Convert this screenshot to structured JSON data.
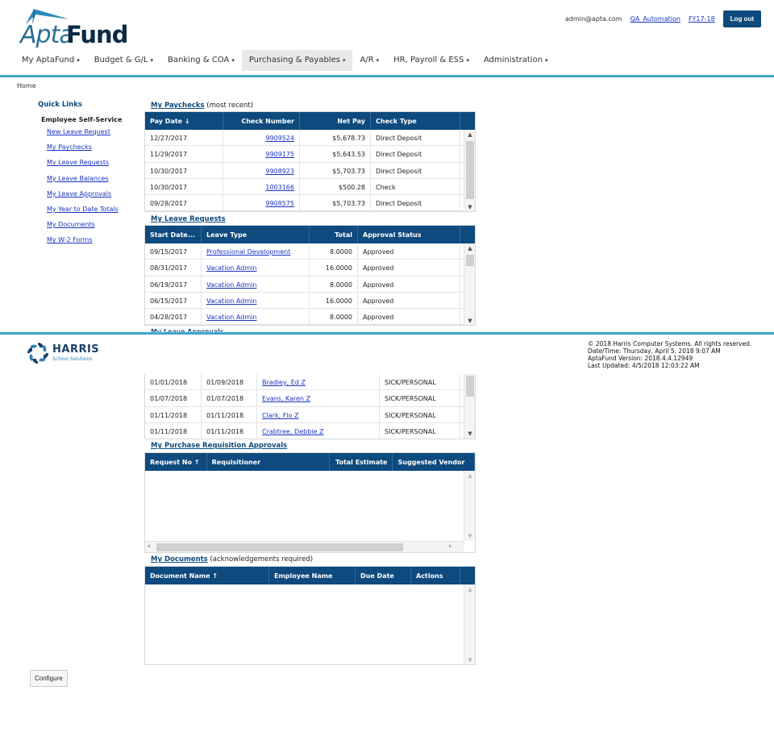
{
  "brand": {
    "apta": "Apta",
    "fund": "Fund"
  },
  "user": {
    "email": "admin@apta.com",
    "name": "QA_Automation",
    "fiscal_year": "FY17-18",
    "logout_label": "Log out"
  },
  "nav": [
    {
      "label": "My AptaFund",
      "caret": "▾"
    },
    {
      "label": "Budget & G/L",
      "caret": "▾"
    },
    {
      "label": "Banking & COA",
      "caret": "▾"
    },
    {
      "label": "Purchasing & Payables",
      "caret": "▾",
      "active": true
    },
    {
      "label": "A/R",
      "caret": "▾"
    },
    {
      "label": "HR, Payroll & ESS",
      "caret": "▾"
    },
    {
      "label": "Administration",
      "caret": "▾"
    }
  ],
  "breadcrumb": "Home",
  "quick_links": {
    "title": "Quick Links",
    "section": "Employee Self-Service",
    "items": [
      "New Leave Request",
      "My Paychecks",
      "My Leave Requests",
      "My Leave Balances",
      "My Leave Approvals",
      "My Year to Date Totals",
      "My Documents",
      "My W-2 Forms"
    ]
  },
  "paychecks": {
    "title": "My Paychecks",
    "suffix": "(most recent)",
    "columns": [
      "Pay Date ↓",
      "Check Number",
      "Net Pay",
      "Check Type"
    ],
    "rows": [
      [
        "12/27/2017",
        "9909524",
        "$5,678.73",
        "Direct Deposit"
      ],
      [
        "11/29/2017",
        "9909175",
        "$5,643.53",
        "Direct Deposit"
      ],
      [
        "10/30/2017",
        "9908923",
        "$5,703.73",
        "Direct Deposit"
      ],
      [
        "10/30/2017",
        "1003166",
        "$500.28",
        "Check"
      ],
      [
        "09/28/2017",
        "9908575",
        "$5,703.73",
        "Direct Deposit"
      ]
    ]
  },
  "leave_requests": {
    "title": "My Leave Requests",
    "columns": [
      "Start Date...",
      "Leave Type",
      "Total",
      "Approval Status"
    ],
    "rows": [
      [
        "09/15/2017",
        "Professional Development",
        "8.0000",
        "Approved"
      ],
      [
        "08/31/2017",
        "Vacation Admin",
        "16.0000",
        "Approved"
      ],
      [
        "06/19/2017",
        "Vacation Admin",
        "8.0000",
        "Approved"
      ],
      [
        "06/15/2017",
        "Vacation Admin",
        "16.0000",
        "Approved"
      ],
      [
        "04/28/2017",
        "Vacation Admin",
        "8.0000",
        "Approved"
      ]
    ]
  },
  "leave_approvals_peek": "My Leave Approvals",
  "leave_approvals": {
    "rows": [
      [
        "01/01/2018",
        "01/09/2018",
        "Bradley, Ed Z",
        "SICK/PERSONAL"
      ],
      [
        "01/07/2018",
        "01/07/2018",
        "Evans, Karen Z",
        "SICK/PERSONAL"
      ],
      [
        "01/11/2018",
        "01/11/2018",
        "Clark, Flo Z",
        "SICK/PERSONAL"
      ],
      [
        "01/11/2018",
        "01/11/2018",
        "Crabtree, Debbie Z",
        "SICK/PERSONAL"
      ]
    ]
  },
  "purchase_approvals": {
    "title": "My Purchase Requisition Approvals",
    "columns": [
      "Request No ↑",
      "Requisitioner",
      "Total Estimate",
      "Suggested Vendor"
    ]
  },
  "documents": {
    "title": "My Documents",
    "suffix": "(acknowledgements required)",
    "columns": [
      "Document Name ↑",
      "Employee Name",
      "Due Date",
      "Actions"
    ]
  },
  "footer": {
    "company": "HARRIS",
    "company_sub": "School Solutions",
    "copyright": "© 2018 Harris Computer Systems. All rights reserved.",
    "datetime": "Date/Time: Thursday, April 5, 2018 9:07 AM",
    "version": "AptaFund Version: 2018.4.4.12949",
    "updated": "Last Updated: 4/5/2018 12:03:22 AM"
  },
  "configure_label": "Configure",
  "colors": {
    "primary": "#0e4a7e",
    "accent": "#3fa6c9",
    "link": "#1a35c4"
  }
}
